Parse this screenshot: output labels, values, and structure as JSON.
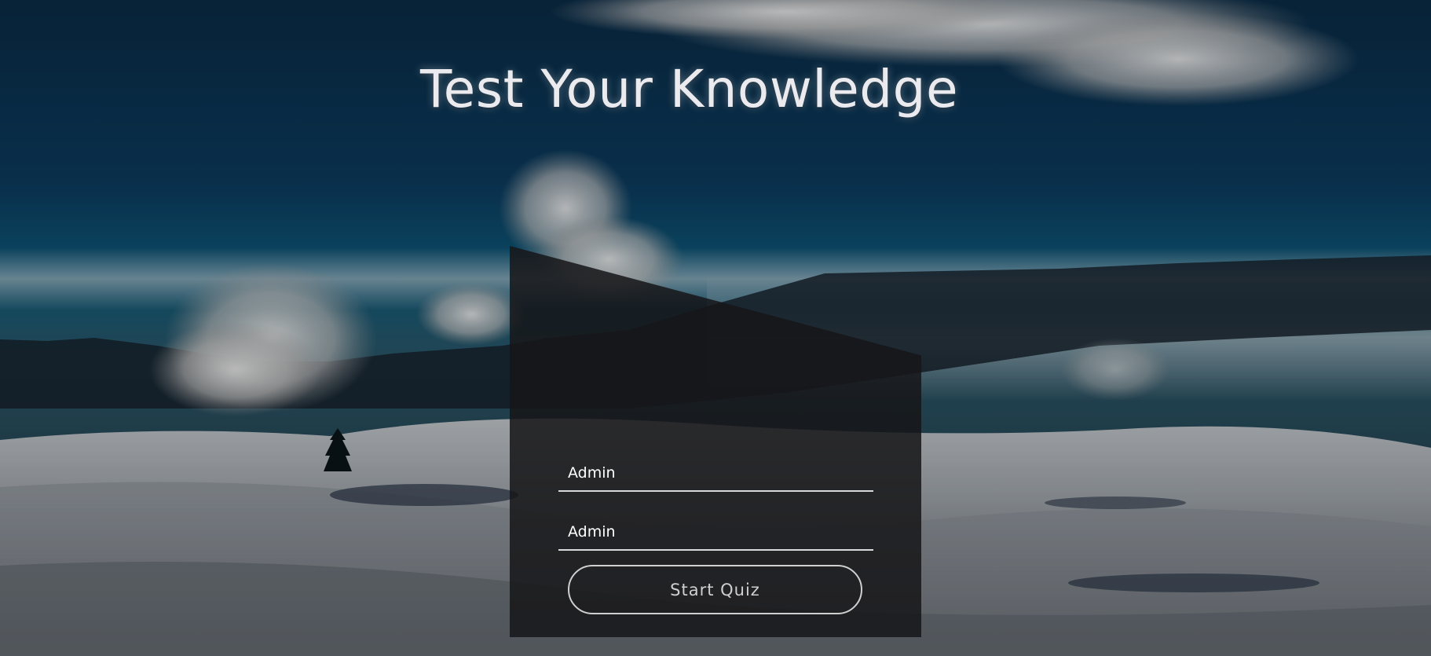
{
  "page": {
    "title": "Test Your Knowledge"
  },
  "form": {
    "username_value": "Admin",
    "password_value": "Admin",
    "start_button_label": "Start Quiz"
  },
  "colors": {
    "sky_dark": "#0b2f4a",
    "sky_teal": "#0e5a78",
    "panel": "#161618",
    "text": "#ebebef",
    "outline": "#cfcfcf"
  }
}
